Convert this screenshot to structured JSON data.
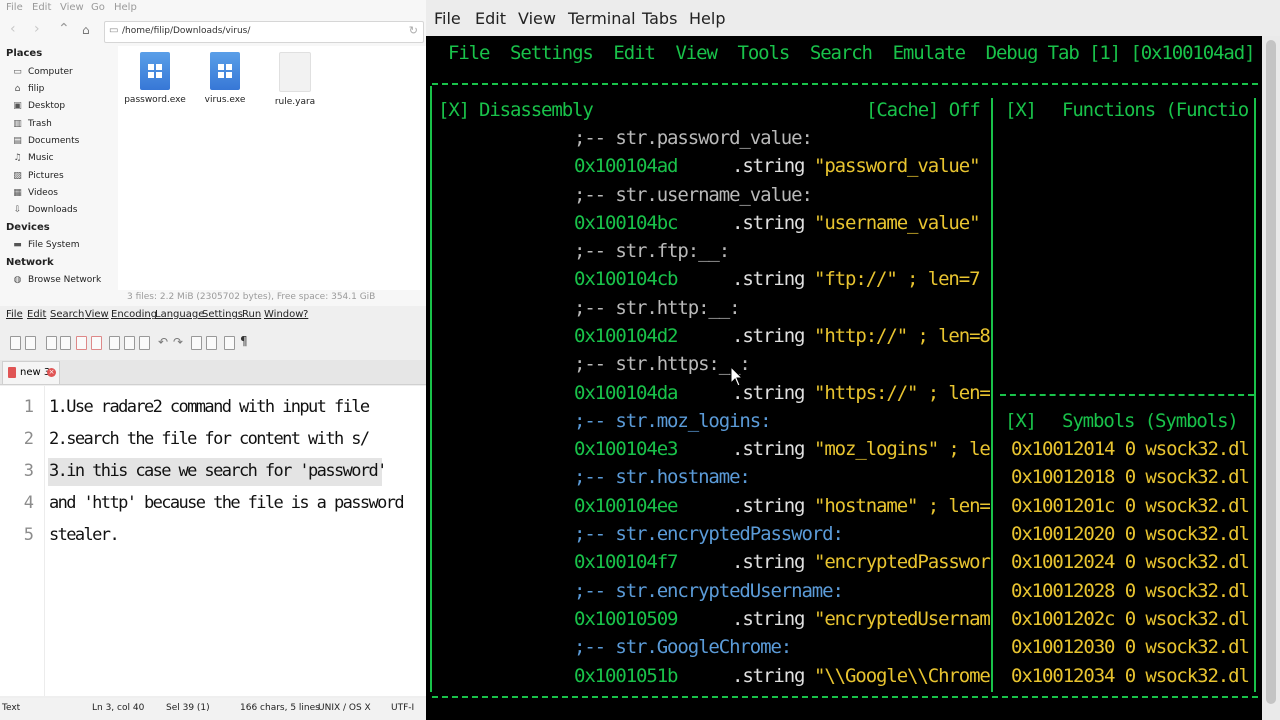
{
  "file_manager": {
    "menu": [
      "File",
      "Edit",
      "View",
      "Go",
      "Help"
    ],
    "path": "/home/filip/Downloads/virus/",
    "places_heading": "Places",
    "places": [
      {
        "label": "Computer",
        "icon": "computer-icon"
      },
      {
        "label": "filip",
        "icon": "home-icon"
      },
      {
        "label": "Desktop",
        "icon": "desktop-icon"
      },
      {
        "label": "Trash",
        "icon": "trash-icon"
      },
      {
        "label": "Documents",
        "icon": "documents-icon"
      },
      {
        "label": "Music",
        "icon": "music-icon"
      },
      {
        "label": "Pictures",
        "icon": "pictures-icon"
      },
      {
        "label": "Videos",
        "icon": "videos-icon"
      },
      {
        "label": "Downloads",
        "icon": "downloads-icon"
      }
    ],
    "devices_heading": "Devices",
    "devices": [
      {
        "label": "File System",
        "icon": "drive-icon"
      }
    ],
    "network_heading": "Network",
    "network": [
      {
        "label": "Browse Network",
        "icon": "network-icon"
      }
    ],
    "files": [
      {
        "name": "password.exe",
        "type": "exe"
      },
      {
        "name": "virus.exe",
        "type": "exe"
      },
      {
        "name": "rule.yara",
        "type": "text"
      }
    ],
    "status": "3 files: 2.2 MiB (2305702 bytes), Free space: 354.1 GiB"
  },
  "editor": {
    "menu": [
      "File",
      "Edit",
      "Search",
      "View",
      "Encoding",
      "Language",
      "Settings",
      "Run",
      "Window",
      "?"
    ],
    "tab_label": "new 3",
    "lines": [
      {
        "num": "1",
        "text": "1.Use radare2 command with input file"
      },
      {
        "num": "2",
        "text": "2.search the file for content with s/"
      },
      {
        "num": "3",
        "text": "3.in this case we search for 'password'"
      },
      {
        "num": "4",
        "text": "and 'http' because the file is a password"
      },
      {
        "num": "5",
        "text": "stealer."
      }
    ],
    "status": {
      "mode": "Text",
      "position": "Ln 3, col 40",
      "selection": "Sel 39 (1)",
      "counts": "166 chars, 5 lines",
      "eol": "UNIX / OS X",
      "encoding": "UTF-I"
    }
  },
  "terminal": {
    "menu": [
      "File",
      "Edit",
      "View",
      "Terminal",
      "Tabs",
      "Help"
    ],
    "r2_menu": "File  Settings  Edit  View  Tools  Search  Emulate  Debug Tab [1] [0x100104ad]",
    "disasm": {
      "close": "[X]",
      "title": "Disassembly",
      "cache": "[Cache] Off",
      "entries": [
        {
          "flag": ";-- str.password_value:",
          "addr": "0x100104ad",
          "op": ".string",
          "arg": "\"password_value\""
        },
        {
          "flag": ";-- str.username_value:",
          "addr": "0x100104bc",
          "op": ".string",
          "arg": "\"username_value\""
        },
        {
          "flag": ";-- str.ftp:__:",
          "addr": "0x100104cb",
          "op": ".string",
          "arg": "\"ftp://\" ; len=7"
        },
        {
          "flag": ";-- str.http:__:",
          "addr": "0x100104d2",
          "op": ".string",
          "arg": "\"http://\" ; len=8"
        },
        {
          "flag": ";-- str.https:__:",
          "addr": "0x100104da",
          "op": ".string",
          "arg": "\"https://\" ; len="
        },
        {
          "flag": ";-- str.moz_logins:",
          "addr": "0x100104e3",
          "op": ".string",
          "arg": "\"moz_logins\" ; le"
        },
        {
          "flag": ";-- str.hostname:",
          "addr": "0x100104ee",
          "op": ".string",
          "arg": "\"hostname\" ; len="
        },
        {
          "flag": ";-- str.encryptedPassword:",
          "addr": "0x100104f7",
          "op": ".string",
          "arg": "\"encryptedPasswor"
        },
        {
          "flag": ";-- str.encryptedUsername:",
          "addr": "0x10010509",
          "op": ".string",
          "arg": "\"encryptedUsernam"
        },
        {
          "flag": ";-- str.GoogleChrome:",
          "addr": "0x1001051b",
          "op": ".string",
          "arg": "\"\\\\Google\\\\Chrome"
        }
      ]
    },
    "functions": {
      "close": "[X]",
      "title": "Functions (Functio"
    },
    "symbols": {
      "close": "[X]",
      "title": "Symbols (Symbols)",
      "rows": [
        "0x10012014 0 wsock32.dl",
        "0x10012018 0 wsock32.dl",
        "0x1001201c 0 wsock32.dl",
        "0x10012020 0 wsock32.dl",
        "0x10012024 0 wsock32.dl",
        "0x10012028 0 wsock32.dl",
        "0x1001202c 0 wsock32.dl",
        "0x10012030 0 wsock32.dl",
        "0x10012034 0 wsock32.dl"
      ]
    }
  },
  "colors": {
    "terminal_bg": "#000000",
    "r2_green": "#19c24a",
    "r2_yellow": "#e8c430",
    "r2_blue": "#5b9bd8"
  }
}
